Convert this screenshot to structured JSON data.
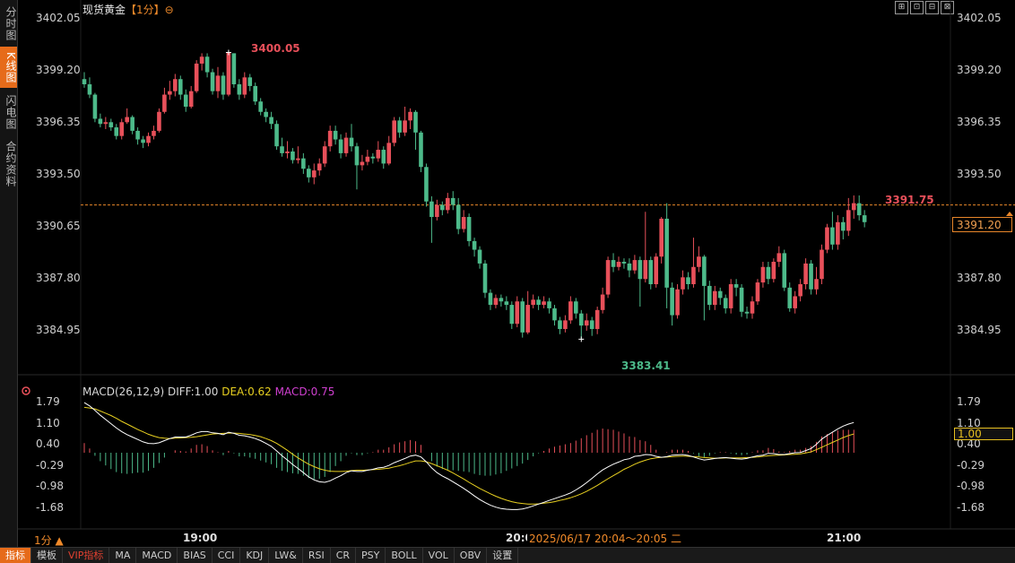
{
  "sidebar": {
    "items": [
      "分时图",
      "K线图",
      "闪电图",
      "合约资料"
    ],
    "active_index": 1
  },
  "header": {
    "instrument": "现货黄金",
    "period_label": "【1分】",
    "settings_glyph": "⊖"
  },
  "window_buttons": [
    "⊞",
    "⊡",
    "⊟",
    "⊠"
  ],
  "price_axis": {
    "ticks": [
      "3402.05",
      "3399.20",
      "3396.35",
      "3393.50",
      "3390.65",
      "3387.80",
      "3384.95"
    ]
  },
  "current_price": "3391.20",
  "annotations": {
    "high": "3400.05",
    "low": "3383.41",
    "recent_high": "3391.75"
  },
  "macd": {
    "legend": "MACD(26,12,9)",
    "diff": "DIFF:1.00",
    "dea": "DEA:0.62",
    "macd": "MACD:0.75",
    "axis_ticks": [
      "1.79",
      "1.10",
      "0.40",
      "-0.29",
      "-0.98",
      "-1.68"
    ],
    "current": "1.00"
  },
  "time_axis": {
    "labels": [
      "19:00",
      "20:00",
      "21:00"
    ]
  },
  "crosshair_time": "2025/06/17 20:04～20:05 二",
  "period_selector": "1分 ▲",
  "bottom_tabs": [
    "指标",
    "模板",
    "VIP指标",
    "MA",
    "MACD",
    "BIAS",
    "CCI",
    "KDJ",
    "LW&",
    "RSI",
    "CR",
    "PSY",
    "BOLL",
    "VOL",
    "OBV",
    "设置"
  ],
  "colors": {
    "up": "#e8505a",
    "down": "#4dba8a",
    "accent": "#e66b1a",
    "diff_line": "#ffffff",
    "dea_line": "#e8d020"
  },
  "chart_data": {
    "type": "candlestick",
    "y_range": [
      3383.0,
      3402.05
    ],
    "macd_range": [
      -1.9,
      1.9
    ],
    "candles": [
      [
        3398.5,
        3398.2,
        3398.9,
        3398.0
      ],
      [
        3398.2,
        3397.6,
        3398.6,
        3397.4
      ],
      [
        3397.6,
        3396.2,
        3397.7,
        3396.0
      ],
      [
        3396.2,
        3395.9,
        3396.5,
        3395.7
      ],
      [
        3395.9,
        3396.0,
        3396.3,
        3395.6
      ],
      [
        3396.0,
        3395.7,
        3396.2,
        3395.5
      ],
      [
        3395.7,
        3395.2,
        3395.9,
        3395.0
      ],
      [
        3395.2,
        3396.0,
        3396.2,
        3395.0
      ],
      [
        3396.0,
        3396.3,
        3396.8,
        3395.9
      ],
      [
        3396.3,
        3395.5,
        3396.4,
        3395.3
      ],
      [
        3395.5,
        3395.0,
        3395.7,
        3394.7
      ],
      [
        3395.0,
        3394.8,
        3395.2,
        3394.5
      ],
      [
        3394.8,
        3395.2,
        3395.4,
        3394.6
      ],
      [
        3395.2,
        3395.5,
        3395.8,
        3395.0
      ],
      [
        3395.5,
        3396.6,
        3396.8,
        3395.4
      ],
      [
        3396.6,
        3397.6,
        3398.0,
        3396.5
      ],
      [
        3397.6,
        3397.8,
        3398.4,
        3397.3
      ],
      [
        3397.8,
        3398.5,
        3398.8,
        3397.5
      ],
      [
        3398.5,
        3397.6,
        3398.7,
        3397.3
      ],
      [
        3397.6,
        3396.9,
        3397.9,
        3396.6
      ],
      [
        3396.9,
        3397.8,
        3398.1,
        3396.8
      ],
      [
        3397.8,
        3399.4,
        3399.6,
        3397.7
      ],
      [
        3399.4,
        3399.8,
        3400.0,
        3399.0
      ],
      [
        3399.8,
        3398.9,
        3400.0,
        3398.6
      ],
      [
        3398.9,
        3397.8,
        3399.1,
        3397.6
      ],
      [
        3397.8,
        3398.7,
        3399.2,
        3397.4
      ],
      [
        3398.7,
        3397.6,
        3398.9,
        3397.3
      ],
      [
        3397.6,
        3400.05,
        3400.05,
        3397.5
      ],
      [
        3400.0,
        3398.2,
        3400.0,
        3398.0
      ],
      [
        3398.2,
        3397.6,
        3398.5,
        3397.3
      ],
      [
        3397.6,
        3398.6,
        3398.9,
        3397.4
      ],
      [
        3398.6,
        3398.1,
        3398.8,
        3397.8
      ],
      [
        3398.1,
        3397.2,
        3398.3,
        3397.0
      ],
      [
        3397.2,
        3396.6,
        3397.4,
        3396.4
      ],
      [
        3396.6,
        3396.3,
        3396.8,
        3396.0
      ],
      [
        3396.3,
        3395.9,
        3396.6,
        3395.6
      ],
      [
        3395.9,
        3394.6,
        3396.1,
        3394.4
      ],
      [
        3394.6,
        3394.2,
        3395.1,
        3394.0
      ],
      [
        3394.2,
        3394.3,
        3394.9,
        3393.9
      ],
      [
        3394.3,
        3393.8,
        3394.5,
        3393.6
      ],
      [
        3393.8,
        3393.9,
        3394.6,
        3393.6
      ],
      [
        3393.9,
        3393.3,
        3394.2,
        3393.0
      ],
      [
        3393.3,
        3392.8,
        3393.5,
        3392.5
      ],
      [
        3392.8,
        3393.2,
        3393.6,
        3392.4
      ],
      [
        3393.2,
        3393.6,
        3393.9,
        3392.9
      ],
      [
        3393.6,
        3394.6,
        3394.9,
        3393.4
      ],
      [
        3394.6,
        3395.5,
        3395.8,
        3394.3
      ],
      [
        3395.5,
        3395.0,
        3395.8,
        3394.7
      ],
      [
        3395.0,
        3394.2,
        3395.3,
        3393.9
      ],
      [
        3394.2,
        3395.1,
        3395.4,
        3394.0
      ],
      [
        3395.1,
        3394.6,
        3395.9,
        3394.3
      ],
      [
        3394.6,
        3393.5,
        3394.8,
        3392.1
      ],
      [
        3393.5,
        3393.7,
        3394.1,
        3393.2
      ],
      [
        3393.7,
        3394.0,
        3394.4,
        3393.5
      ],
      [
        3394.0,
        3393.9,
        3394.2,
        3393.6
      ],
      [
        3393.9,
        3394.4,
        3394.9,
        3393.7
      ],
      [
        3394.4,
        3393.6,
        3394.6,
        3393.3
      ],
      [
        3393.6,
        3394.8,
        3395.2,
        3393.5
      ],
      [
        3394.8,
        3396.1,
        3396.3,
        3394.6
      ],
      [
        3396.1,
        3395.4,
        3396.3,
        3395.1
      ],
      [
        3395.4,
        3396.1,
        3396.9,
        3395.2
      ],
      [
        3396.1,
        3396.6,
        3396.8,
        3395.6
      ],
      [
        3396.6,
        3395.4,
        3396.7,
        3394.4
      ],
      [
        3395.4,
        3393.4,
        3395.5,
        3393.1
      ],
      [
        3393.4,
        3391.4,
        3393.6,
        3391.1
      ],
      [
        3391.4,
        3390.5,
        3391.7,
        3389.0
      ],
      [
        3390.5,
        3391.2,
        3391.5,
        3390.3
      ],
      [
        3391.2,
        3390.9,
        3391.4,
        3390.6
      ],
      [
        3390.9,
        3391.6,
        3391.9,
        3390.7
      ],
      [
        3391.6,
        3391.2,
        3392.0,
        3390.9
      ],
      [
        3391.2,
        3389.8,
        3391.6,
        3389.5
      ],
      [
        3389.8,
        3390.5,
        3390.9,
        3389.6
      ],
      [
        3390.5,
        3389.1,
        3390.7,
        3388.8
      ],
      [
        3389.1,
        3388.6,
        3389.3,
        3388.2
      ],
      [
        3388.6,
        3387.8,
        3388.8,
        3387.5
      ],
      [
        3387.8,
        3386.1,
        3388.0,
        3385.8
      ],
      [
        3386.1,
        3385.4,
        3386.3,
        3385.1
      ],
      [
        3385.4,
        3385.8,
        3386.0,
        3385.2
      ],
      [
        3385.8,
        3385.6,
        3386.0,
        3385.3
      ],
      [
        3385.6,
        3385.4,
        3385.9,
        3385.1
      ],
      [
        3385.4,
        3384.3,
        3385.6,
        3384.0
      ],
      [
        3384.3,
        3385.6,
        3385.9,
        3384.1
      ],
      [
        3385.6,
        3383.8,
        3385.8,
        3383.5
      ],
      [
        3383.8,
        3385.4,
        3386.2,
        3383.7
      ],
      [
        3385.4,
        3385.7,
        3386.0,
        3385.2
      ],
      [
        3385.7,
        3385.4,
        3385.9,
        3385.1
      ],
      [
        3385.4,
        3385.6,
        3385.9,
        3385.2
      ],
      [
        3385.6,
        3385.2,
        3385.8,
        3384.9
      ],
      [
        3385.2,
        3384.5,
        3385.4,
        3384.2
      ],
      [
        3384.5,
        3384.0,
        3384.7,
        3383.7
      ],
      [
        3384.0,
        3384.5,
        3384.8,
        3383.8
      ],
      [
        3384.5,
        3385.6,
        3385.9,
        3384.3
      ],
      [
        3385.6,
        3384.9,
        3385.8,
        3384.6
      ],
      [
        3384.9,
        3384.2,
        3385.1,
        3383.41
      ],
      [
        3384.2,
        3384.5,
        3384.9,
        3383.9
      ],
      [
        3384.5,
        3384.0,
        3384.7,
        3383.6
      ],
      [
        3384.0,
        3385.1,
        3385.3,
        3383.7
      ],
      [
        3385.1,
        3386.0,
        3386.4,
        3384.9
      ],
      [
        3386.0,
        3388.0,
        3388.2,
        3385.8
      ],
      [
        3388.0,
        3387.6,
        3388.4,
        3387.3
      ],
      [
        3387.6,
        3387.9,
        3388.2,
        3387.4
      ],
      [
        3387.9,
        3387.8,
        3388.1,
        3387.5
      ],
      [
        3387.8,
        3387.4,
        3388.1,
        3387.0
      ],
      [
        3387.4,
        3388.0,
        3388.3,
        3387.2
      ],
      [
        3388.0,
        3386.9,
        3388.2,
        3385.3
      ],
      [
        3386.9,
        3388.0,
        3390.8,
        3386.7
      ],
      [
        3388.0,
        3386.6,
        3388.2,
        3386.3
      ],
      [
        3386.6,
        3388.2,
        3388.4,
        3386.4
      ],
      [
        3388.2,
        3390.4,
        3390.5,
        3387.8
      ],
      [
        3390.4,
        3386.4,
        3391.3,
        3385.2
      ],
      [
        3386.4,
        3384.8,
        3386.7,
        3384.2
      ],
      [
        3384.8,
        3386.3,
        3386.6,
        3384.6
      ],
      [
        3386.3,
        3387.0,
        3387.4,
        3386.0
      ],
      [
        3387.0,
        3386.6,
        3387.3,
        3386.3
      ],
      [
        3386.6,
        3387.6,
        3389.3,
        3386.4
      ],
      [
        3387.6,
        3388.2,
        3388.8,
        3387.3
      ],
      [
        3388.2,
        3386.5,
        3388.3,
        3384.5
      ],
      [
        3386.5,
        3385.4,
        3386.8,
        3385.1
      ],
      [
        3385.4,
        3386.2,
        3386.5,
        3385.1
      ],
      [
        3386.2,
        3385.8,
        3386.4,
        3385.4
      ],
      [
        3385.8,
        3385.2,
        3386.0,
        3384.9
      ],
      [
        3385.2,
        3386.6,
        3386.9,
        3384.9
      ],
      [
        3386.6,
        3386.4,
        3386.9,
        3385.9
      ],
      [
        3386.4,
        3385.0,
        3386.6,
        3384.7
      ],
      [
        3385.0,
        3384.9,
        3385.3,
        3384.6
      ],
      [
        3384.9,
        3385.6,
        3385.9,
        3384.6
      ],
      [
        3385.6,
        3386.7,
        3386.9,
        3385.4
      ],
      [
        3386.7,
        3387.6,
        3387.9,
        3386.4
      ],
      [
        3387.6,
        3386.9,
        3387.9,
        3386.6
      ],
      [
        3386.9,
        3387.9,
        3388.1,
        3386.7
      ],
      [
        3387.9,
        3388.4,
        3388.8,
        3387.6
      ],
      [
        3388.4,
        3386.4,
        3388.6,
        3386.2
      ],
      [
        3386.4,
        3385.2,
        3386.7,
        3385.0
      ],
      [
        3385.2,
        3385.9,
        3386.2,
        3384.9
      ],
      [
        3385.9,
        3386.6,
        3386.9,
        3385.6
      ],
      [
        3386.6,
        3387.8,
        3388.1,
        3386.3
      ],
      [
        3387.8,
        3386.3,
        3388.0,
        3386.0
      ],
      [
        3386.3,
        3386.9,
        3387.6,
        3386.0
      ],
      [
        3386.9,
        3388.6,
        3388.9,
        3386.6
      ],
      [
        3388.6,
        3389.9,
        3390.1,
        3388.4
      ],
      [
        3389.9,
        3388.9,
        3390.8,
        3388.6
      ],
      [
        3388.9,
        3390.2,
        3390.6,
        3388.6
      ],
      [
        3390.2,
        3389.7,
        3390.5,
        3389.2
      ],
      [
        3389.7,
        3390.9,
        3391.6,
        3389.4
      ],
      [
        3390.9,
        3391.3,
        3391.75,
        3390.4
      ],
      [
        3391.3,
        3390.6,
        3391.75,
        3390.3
      ],
      [
        3390.6,
        3390.2,
        3390.9,
        3389.9
      ]
    ],
    "macd_dif": [
      1.66,
      1.55,
      1.4,
      1.24,
      1.1,
      0.96,
      0.82,
      0.7,
      0.6,
      0.52,
      0.44,
      0.36,
      0.31,
      0.3,
      0.33,
      0.4,
      0.47,
      0.52,
      0.52,
      0.52,
      0.58,
      0.66,
      0.7,
      0.7,
      0.66,
      0.64,
      0.6,
      0.68,
      0.64,
      0.58,
      0.56,
      0.52,
      0.47,
      0.4,
      0.31,
      0.21,
      0.06,
      -0.1,
      -0.24,
      -0.39,
      -0.52,
      -0.66,
      -0.8,
      -0.9,
      -0.96,
      -0.98,
      -0.93,
      -0.84,
      -0.76,
      -0.66,
      -0.6,
      -0.62,
      -0.62,
      -0.58,
      -0.55,
      -0.5,
      -0.48,
      -0.42,
      -0.33,
      -0.26,
      -0.19,
      -0.11,
      -0.08,
      -0.14,
      -0.3,
      -0.5,
      -0.66,
      -0.77,
      -0.86,
      -0.96,
      -1.07,
      -1.18,
      -1.3,
      -1.43,
      -1.55,
      -1.65,
      -1.74,
      -1.8,
      -1.85,
      -1.87,
      -1.88,
      -1.88,
      -1.86,
      -1.82,
      -1.76,
      -1.7,
      -1.64,
      -1.58,
      -1.52,
      -1.46,
      -1.4,
      -1.33,
      -1.23,
      -1.12,
      -0.99,
      -0.85,
      -0.7,
      -0.57,
      -0.47,
      -0.38,
      -0.31,
      -0.23,
      -0.2,
      -0.12,
      -0.1,
      -0.06,
      -0.07,
      -0.12,
      -0.15,
      -0.13,
      -0.08,
      -0.07,
      -0.06,
      -0.09,
      -0.14,
      -0.2,
      -0.24,
      -0.22,
      -0.19,
      -0.17,
      -0.16,
      -0.18,
      -0.2,
      -0.21,
      -0.19,
      -0.14,
      -0.1,
      -0.08,
      -0.02,
      -0.03,
      -0.06,
      -0.06,
      -0.03,
      0.0,
      0.01,
      0.07,
      0.14,
      0.28,
      0.45,
      0.57,
      0.68,
      0.79,
      0.88,
      0.95,
      1.0
    ],
    "macd_dea": [
      1.5,
      1.48,
      1.45,
      1.38,
      1.31,
      1.23,
      1.14,
      1.04,
      0.95,
      0.86,
      0.77,
      0.69,
      0.61,
      0.55,
      0.5,
      0.48,
      0.47,
      0.48,
      0.49,
      0.5,
      0.51,
      0.53,
      0.56,
      0.59,
      0.62,
      0.63,
      0.64,
      0.65,
      0.65,
      0.64,
      0.62,
      0.6,
      0.57,
      0.53,
      0.47,
      0.4,
      0.31,
      0.2,
      0.08,
      -0.05,
      -0.17,
      -0.28,
      -0.38,
      -0.46,
      -0.53,
      -0.58,
      -0.61,
      -0.62,
      -0.62,
      -0.61,
      -0.59,
      -0.58,
      -0.58,
      -0.57,
      -0.56,
      -0.55,
      -0.53,
      -0.51,
      -0.47,
      -0.43,
      -0.38,
      -0.32,
      -0.27,
      -0.27,
      -0.3,
      -0.36,
      -0.43,
      -0.5,
      -0.58,
      -0.67,
      -0.77,
      -0.87,
      -0.98,
      -1.08,
      -1.18,
      -1.27,
      -1.36,
      -1.44,
      -1.51,
      -1.57,
      -1.62,
      -1.66,
      -1.68,
      -1.7,
      -1.7,
      -1.69,
      -1.67,
      -1.65,
      -1.62,
      -1.58,
      -1.54,
      -1.49,
      -1.43,
      -1.36,
      -1.28,
      -1.18,
      -1.08,
      -0.97,
      -0.86,
      -0.76,
      -0.66,
      -0.55,
      -0.47,
      -0.38,
      -0.31,
      -0.25,
      -0.2,
      -0.17,
      -0.15,
      -0.14,
      -0.13,
      -0.12,
      -0.11,
      -0.12,
      -0.13,
      -0.14,
      -0.16,
      -0.17,
      -0.18,
      -0.18,
      -0.17,
      -0.17,
      -0.17,
      -0.17,
      -0.16,
      -0.15,
      -0.14,
      -0.12,
      -0.1,
      -0.09,
      -0.08,
      -0.07,
      -0.06,
      -0.05,
      -0.04,
      -0.01,
      0.03,
      0.1,
      0.18,
      0.26,
      0.34,
      0.42,
      0.5,
      0.57,
      0.62
    ]
  }
}
